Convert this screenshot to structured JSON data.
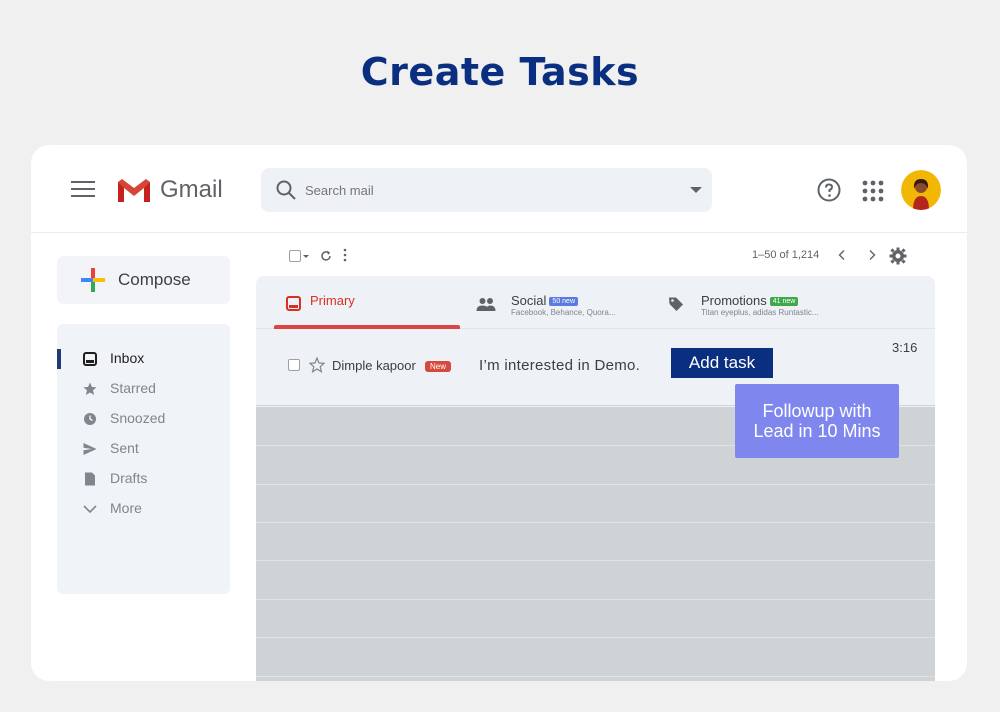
{
  "page": {
    "title": "Create Tasks"
  },
  "header": {
    "logo_text": "Gmail",
    "search_placeholder": "Search mail"
  },
  "sidebar": {
    "compose_label": "Compose",
    "items": [
      {
        "label": "Inbox",
        "icon": "inbox-icon",
        "active": true
      },
      {
        "label": "Starred",
        "icon": "star-icon",
        "active": false
      },
      {
        "label": "Snoozed",
        "icon": "clock-icon",
        "active": false
      },
      {
        "label": "Sent",
        "icon": "send-icon",
        "active": false
      },
      {
        "label": "Drafts",
        "icon": "draft-icon",
        "active": false
      },
      {
        "label": "More",
        "icon": "chevron-down-icon",
        "active": false
      }
    ]
  },
  "toolbar": {
    "pager_text": "1–50 of 1,214"
  },
  "tabs": [
    {
      "name": "Primary",
      "badge": "",
      "sub": "",
      "icon": "inbox-icon"
    },
    {
      "name": "Social",
      "badge": "50 new",
      "sub": "Facebook, Behance, Quora...",
      "icon": "people-icon",
      "badge_color": "#5b7be0"
    },
    {
      "name": "Promotions",
      "badge": "41 new",
      "sub": "Titan eyeplus, adidas Runtastic...",
      "icon": "tag-icon",
      "badge_color": "#3ea84a"
    }
  ],
  "mail": {
    "sender": "Dimple kapoor",
    "new_badge": "New",
    "subject": "I’m interested in Demo.",
    "time": "3:16"
  },
  "actions": {
    "add_task_label": "Add task"
  },
  "tooltip": {
    "line1": "Followup with",
    "line2": "Lead in 10 Mins"
  },
  "colors": {
    "title": "#0b2f80",
    "add_task_bg": "#0b2f80",
    "tooltip_bg": "#7f86ee",
    "primary_tab": "#d93025",
    "new_badge": "#d54a3e"
  }
}
